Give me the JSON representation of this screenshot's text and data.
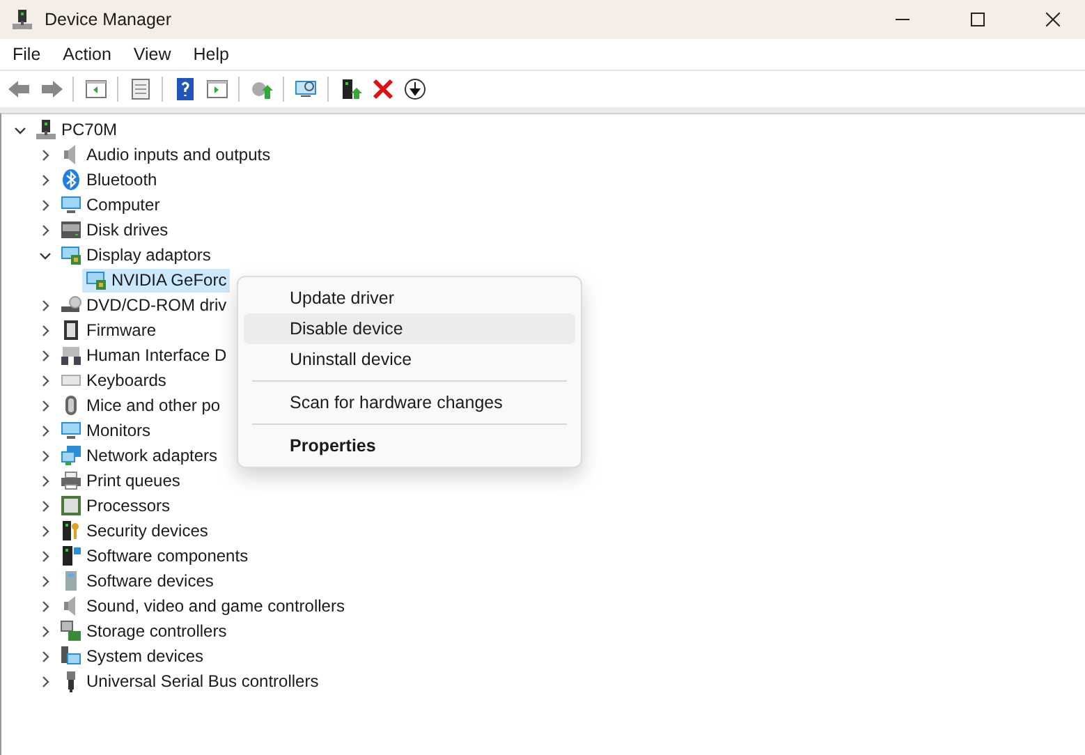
{
  "window": {
    "title": "Device Manager"
  },
  "menu_bar": [
    {
      "label": "File"
    },
    {
      "label": "Action"
    },
    {
      "label": "View"
    },
    {
      "label": "Help"
    }
  ],
  "tree": {
    "label": "PC70M",
    "expanded": true,
    "selected": false,
    "children": [
      {
        "label": "Audio inputs and outputs",
        "expanded": false,
        "selected": false
      },
      {
        "label": "Bluetooth",
        "expanded": false,
        "selected": false
      },
      {
        "label": "Computer",
        "expanded": false,
        "selected": false
      },
      {
        "label": "Disk drives",
        "expanded": false,
        "selected": false
      },
      {
        "label": "Display adaptors",
        "expanded": true,
        "selected": false,
        "children": [
          {
            "label": "NVIDIA GeForc",
            "selected": true
          }
        ]
      },
      {
        "label": "DVD/CD-ROM driv",
        "expanded": false,
        "selected": false
      },
      {
        "label": "Firmware",
        "expanded": false,
        "selected": false
      },
      {
        "label": "Human Interface D",
        "expanded": false,
        "selected": false
      },
      {
        "label": "Keyboards",
        "expanded": false,
        "selected": false
      },
      {
        "label": "Mice and other po",
        "expanded": false,
        "selected": false
      },
      {
        "label": "Monitors",
        "expanded": false,
        "selected": false
      },
      {
        "label": "Network adapters",
        "expanded": false,
        "selected": false
      },
      {
        "label": "Print queues",
        "expanded": false,
        "selected": false
      },
      {
        "label": "Processors",
        "expanded": false,
        "selected": false
      },
      {
        "label": "Security devices",
        "expanded": false,
        "selected": false
      },
      {
        "label": "Software components",
        "expanded": false,
        "selected": false
      },
      {
        "label": "Software devices",
        "expanded": false,
        "selected": false
      },
      {
        "label": "Sound, video and game controllers",
        "expanded": false,
        "selected": false
      },
      {
        "label": "Storage controllers",
        "expanded": false,
        "selected": false
      },
      {
        "label": "System devices",
        "expanded": false,
        "selected": false
      },
      {
        "label": "Universal Serial Bus controllers",
        "expanded": false,
        "selected": false
      }
    ]
  },
  "context_menu": [
    {
      "kind": "item",
      "label": "Update driver",
      "highlighted": false,
      "default": false
    },
    {
      "kind": "item",
      "label": "Disable device",
      "highlighted": true,
      "default": false
    },
    {
      "kind": "item",
      "label": "Uninstall device",
      "highlighted": false,
      "default": false
    },
    {
      "kind": "separator"
    },
    {
      "kind": "item",
      "label": "Scan for hardware changes",
      "highlighted": false,
      "default": false
    },
    {
      "kind": "separator"
    },
    {
      "kind": "item",
      "label": "Properties",
      "highlighted": false,
      "default": true
    }
  ]
}
